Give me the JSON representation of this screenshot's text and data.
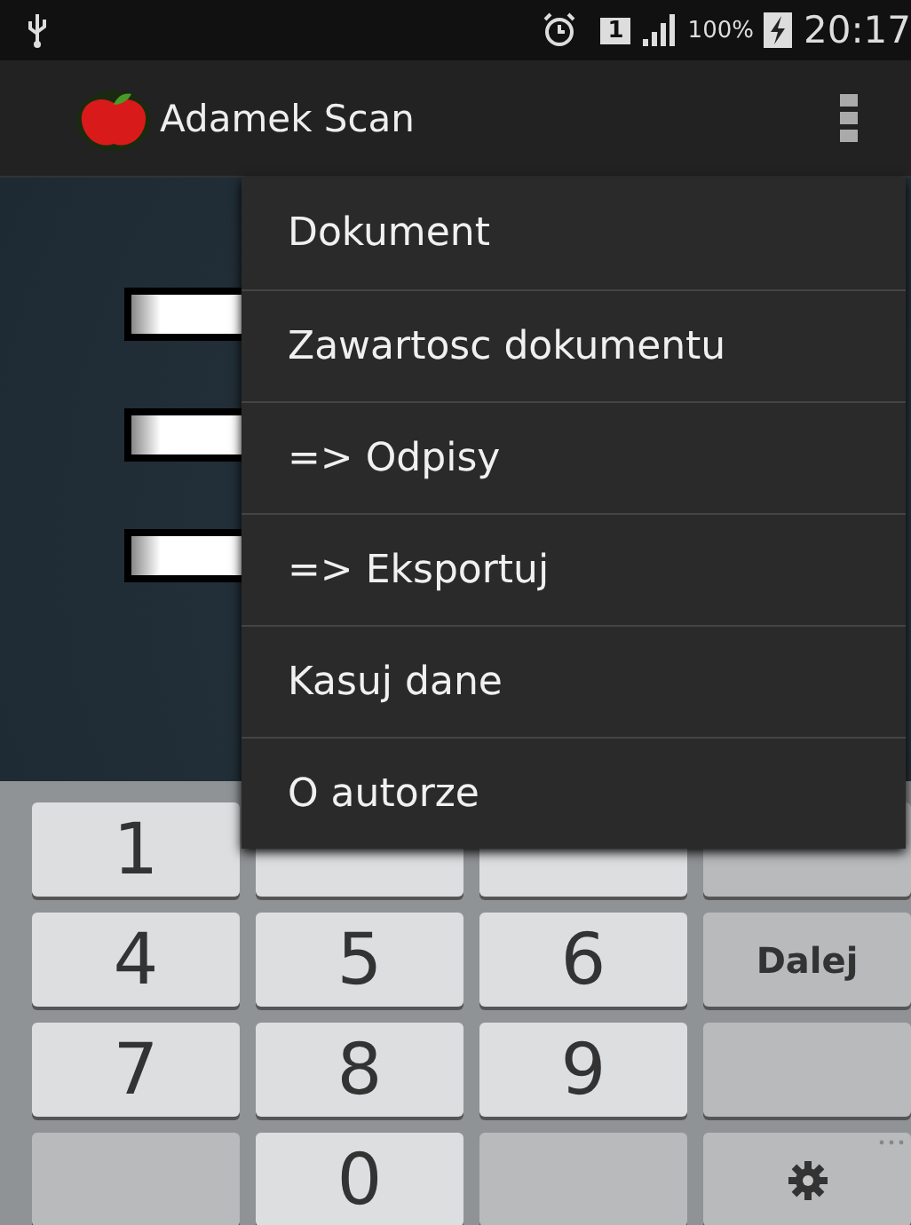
{
  "status_bar": {
    "sim": "1",
    "battery": "100%",
    "time": "20:17"
  },
  "action_bar": {
    "title": "Adamek Scan"
  },
  "fields": [
    {
      "kind": "input"
    },
    {
      "kind": "input"
    },
    {
      "kind": "input"
    }
  ],
  "menu": {
    "items": [
      {
        "label": "Dokument"
      },
      {
        "label": "Zawartosc dokumentu"
      },
      {
        "label": "=> Odpisy"
      },
      {
        "label": "=> Eksportuj"
      },
      {
        "label": "Kasuj dane"
      },
      {
        "label": "O autorze"
      }
    ]
  },
  "keyboard": {
    "keys": [
      {
        "kind": "digit",
        "label": "1"
      },
      {
        "kind": "digit"
      },
      {
        "kind": "digit"
      },
      {
        "kind": "backspace"
      },
      {
        "kind": "digit",
        "label": "4"
      },
      {
        "kind": "digit",
        "label": "5"
      },
      {
        "kind": "digit",
        "label": "6"
      },
      {
        "kind": "action",
        "label": "Dalej"
      },
      {
        "kind": "digit",
        "label": "7"
      },
      {
        "kind": "digit",
        "label": "8"
      },
      {
        "kind": "digit",
        "label": "9"
      },
      {
        "kind": "empty"
      },
      {
        "kind": "empty"
      },
      {
        "kind": "digit",
        "label": "0"
      },
      {
        "kind": "empty"
      },
      {
        "kind": "settings"
      }
    ]
  }
}
